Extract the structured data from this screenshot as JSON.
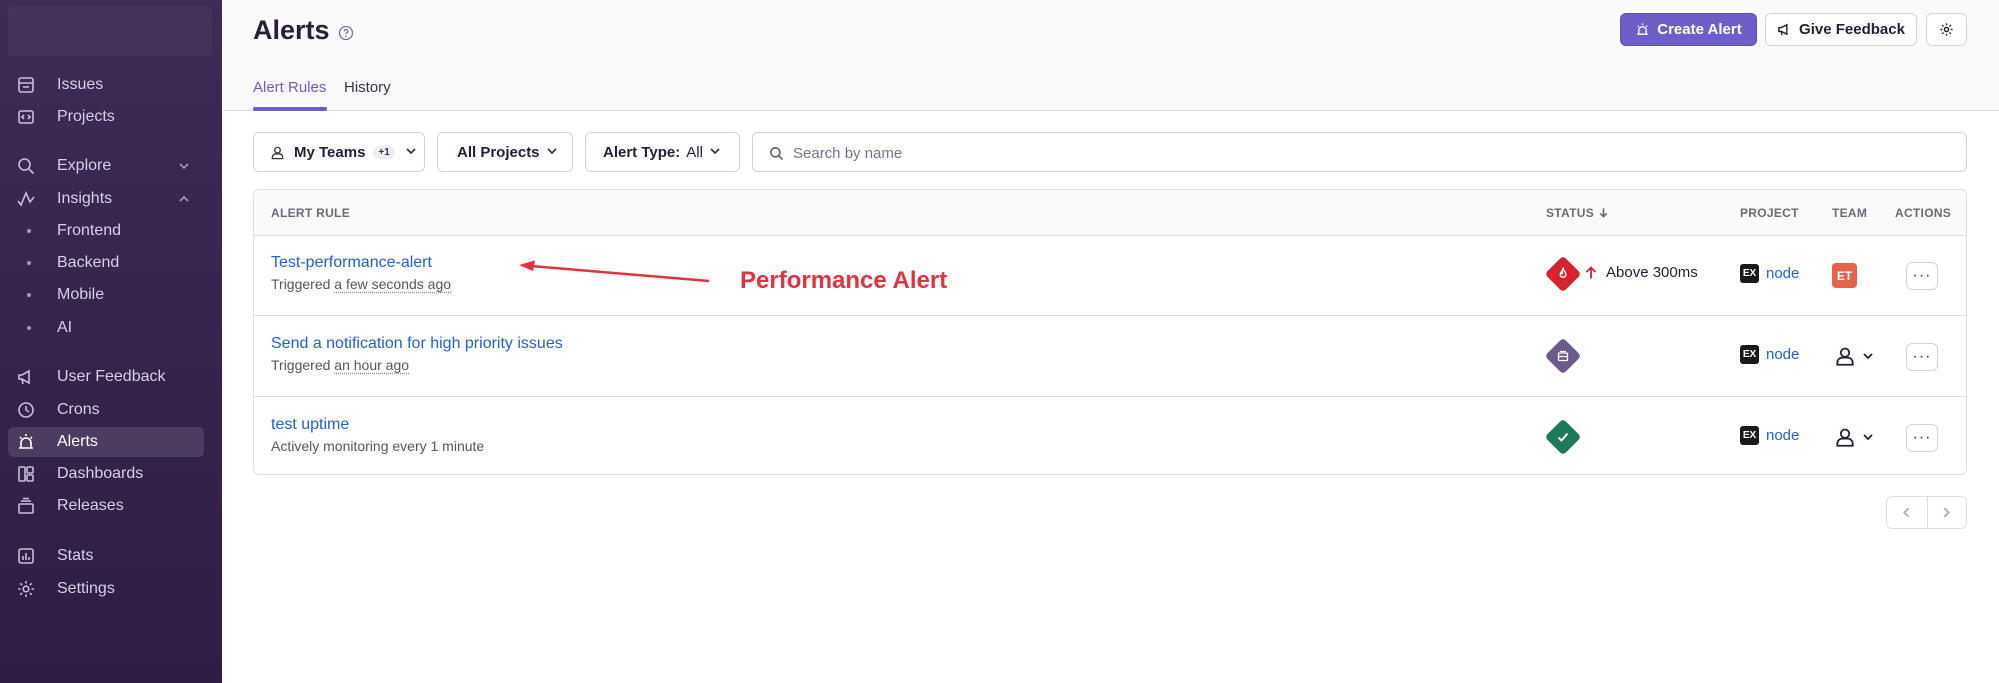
{
  "sidebar": {
    "items": [
      {
        "label": "Issues",
        "icon": "issues-icon"
      },
      {
        "label": "Projects",
        "icon": "projects-icon"
      },
      {
        "label": "Explore",
        "icon": "explore-icon"
      },
      {
        "label": "Insights",
        "icon": "insights-icon"
      },
      {
        "label": "Frontend"
      },
      {
        "label": "Backend"
      },
      {
        "label": "Mobile"
      },
      {
        "label": "AI"
      },
      {
        "label": "User Feedback",
        "icon": "megaphone-icon"
      },
      {
        "label": "Crons",
        "icon": "crons-icon"
      },
      {
        "label": "Alerts",
        "icon": "siren-icon"
      },
      {
        "label": "Dashboards",
        "icon": "dashboards-icon"
      },
      {
        "label": "Releases",
        "icon": "releases-icon"
      },
      {
        "label": "Stats",
        "icon": "stats-icon"
      },
      {
        "label": "Settings",
        "icon": "settings-icon"
      }
    ]
  },
  "header": {
    "title": "Alerts",
    "create_alert": "Create Alert",
    "give_feedback": "Give Feedback",
    "tabs": [
      {
        "label": "Alert Rules"
      },
      {
        "label": "History"
      }
    ]
  },
  "filters": {
    "teams": {
      "label": "My Teams",
      "extra": "+1"
    },
    "projects": {
      "label": "All Projects"
    },
    "alert_type": {
      "label": "Alert Type:",
      "value": "All"
    },
    "search_placeholder": "Search by name"
  },
  "table": {
    "columns": {
      "alert_rule": "ALERT RULE",
      "status": "STATUS",
      "project": "PROJECT",
      "team": "TEAM",
      "actions": "ACTIONS"
    },
    "rows": [
      {
        "name": "Test-performance-alert",
        "sub_prefix": "Triggered",
        "sub_time": "a few seconds ago",
        "status_text": "Above 300ms",
        "status_color": "#d7232f",
        "project_icon": "EX",
        "project": "node",
        "team_badge": "ET",
        "actions": "···"
      },
      {
        "name": "Send a notification for high priority issues",
        "sub_prefix": "Triggered",
        "sub_time": "an hour ago",
        "status_color": "#6e5a8a",
        "project_icon": "EX",
        "project": "node",
        "actions": "···"
      },
      {
        "name": "test uptime",
        "sub_prefix": "Actively monitoring every 1 minute",
        "sub_time": "",
        "status_color": "#1f7a5c",
        "project_icon": "EX",
        "project": "node",
        "actions": "···"
      }
    ]
  },
  "annotation": {
    "label": "Performance Alert",
    "color": "#e0353f"
  },
  "colors": {
    "accent": "#6c5fc7",
    "link": "#2562d4",
    "sidebar_bg": "#3f2b56"
  }
}
